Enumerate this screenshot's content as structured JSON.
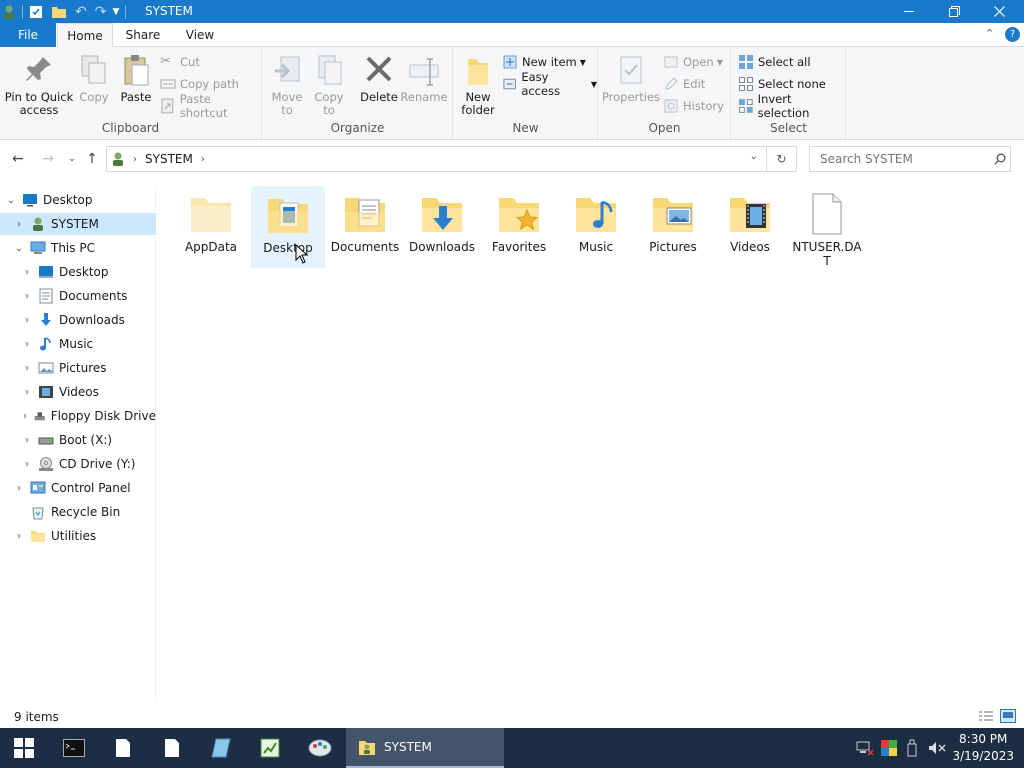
{
  "window": {
    "title": "SYSTEM"
  },
  "tabs": {
    "file": "File",
    "home": "Home",
    "share": "Share",
    "view": "View"
  },
  "ribbon": {
    "clipboard": {
      "label": "Clipboard",
      "pin": "Pin to Quick access",
      "copy": "Copy",
      "paste": "Paste",
      "cut": "Cut",
      "copy_path": "Copy path",
      "paste_shortcut": "Paste shortcut"
    },
    "organize": {
      "label": "Organize",
      "move_to": "Move to",
      "copy_to": "Copy to",
      "delete": "Delete",
      "rename": "Rename"
    },
    "new": {
      "label": "New",
      "new_folder": "New folder",
      "new_item": "New item",
      "easy_access": "Easy access"
    },
    "open": {
      "label": "Open",
      "properties": "Properties",
      "open": "Open",
      "edit": "Edit",
      "history": "History"
    },
    "select": {
      "label": "Select",
      "select_all": "Select all",
      "select_none": "Select none",
      "invert": "Invert selection"
    }
  },
  "address": {
    "path": "SYSTEM",
    "search_placeholder": "Search SYSTEM"
  },
  "tree": [
    {
      "label": "Desktop"
    },
    {
      "label": "SYSTEM"
    },
    {
      "label": "This PC"
    },
    {
      "label": "Desktop"
    },
    {
      "label": "Documents"
    },
    {
      "label": "Downloads"
    },
    {
      "label": "Music"
    },
    {
      "label": "Pictures"
    },
    {
      "label": "Videos"
    },
    {
      "label": "Floppy Disk Drive"
    },
    {
      "label": "Boot (X:)"
    },
    {
      "label": "CD Drive (Y:)"
    },
    {
      "label": "Control Panel"
    },
    {
      "label": "Recycle Bin"
    },
    {
      "label": "Utilities"
    }
  ],
  "items": [
    {
      "label": "AppData"
    },
    {
      "label": "Desktop"
    },
    {
      "label": "Documents"
    },
    {
      "label": "Downloads"
    },
    {
      "label": "Favorites"
    },
    {
      "label": "Music"
    },
    {
      "label": "Pictures"
    },
    {
      "label": "Videos"
    },
    {
      "label": "NTUSER.DAT"
    }
  ],
  "status": {
    "count": "9 items"
  },
  "taskbar": {
    "app": "SYSTEM",
    "time": "8:30 PM",
    "date": "3/19/2023"
  },
  "colors": {
    "accent": "#1979ca",
    "selection": "#cce8ff",
    "folder": "#f8d775",
    "taskbar": "#1d2d44"
  }
}
